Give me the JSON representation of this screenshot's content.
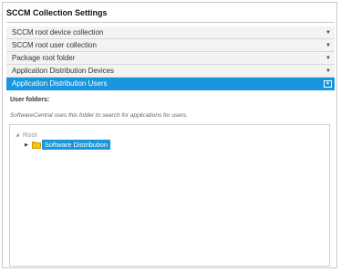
{
  "window": {
    "title": "SCCM Collection Settings"
  },
  "sections": [
    {
      "label": "SCCM root device collection",
      "active": false
    },
    {
      "label": "SCCM root user collection",
      "active": false
    },
    {
      "label": "Package root folder",
      "active": false
    },
    {
      "label": "Application Distribution Devices",
      "active": false
    },
    {
      "label": "Application Distribution Users",
      "active": true
    }
  ],
  "icons": {
    "expand": "chevron-down-icon",
    "collapse": "collapse-up-icon",
    "folder": "folder-icon"
  },
  "panel": {
    "user_folders_label": "User folders:",
    "hint": "SoftwareCentral uses this folder to search for applications for users.",
    "tree": {
      "root_label": "Root",
      "child_label": "Software Distribution"
    }
  },
  "colors": {
    "accent": "#1a96dd",
    "header_bg": "#f3f3f3",
    "folder": "#f5c518"
  }
}
